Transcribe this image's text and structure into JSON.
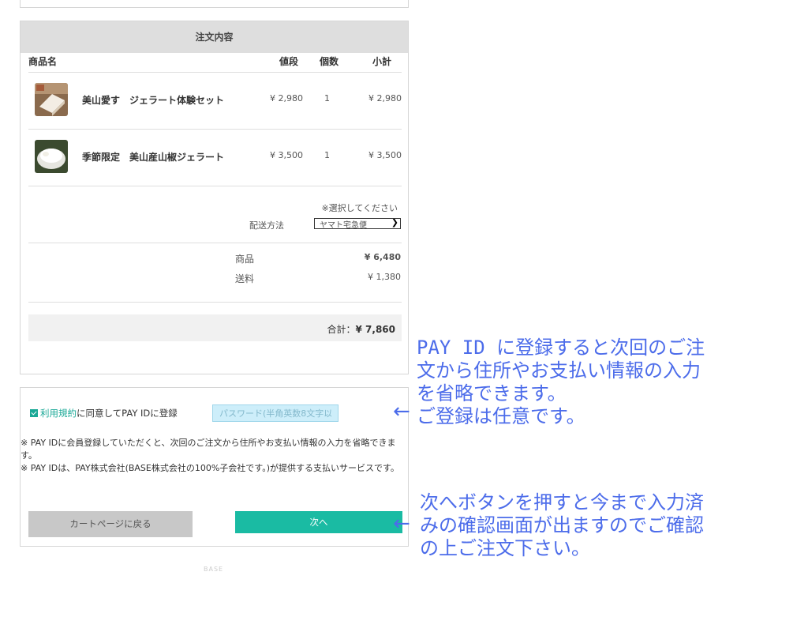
{
  "order": {
    "header": "注文内容",
    "columns": {
      "name": "商品名",
      "price": "値段",
      "qty": "個数",
      "subtotal": "小計"
    },
    "items": [
      {
        "name": "美山愛す　ジェラート体験セット",
        "price": "¥ 2,980",
        "qty": "1",
        "subtotal": "¥ 2,980"
      },
      {
        "name": "季節限定　美山産山椒ジェラート",
        "price": "¥ 3,500",
        "qty": "1",
        "subtotal": "¥ 3,500"
      }
    ],
    "shipping": {
      "note": "※選択してください",
      "label": "配送方法",
      "selected": "ヤマト宅急便"
    },
    "summary": {
      "products_label": "商品",
      "products_value": "¥ 6,480",
      "shipping_label": "送料",
      "shipping_value": "¥ 1,380"
    },
    "total": {
      "label": "合計：",
      "value": "¥ 7,860"
    }
  },
  "pay_id": {
    "terms_link": "利用規約",
    "agree_text": "に同意してPAY IDに登録",
    "password_placeholder": "パスワード(半角英数8文字以上)",
    "note1": "※ PAY IDに会員登録していただくと、次回のご注文から住所やお支払い情報の入力を省略できます。",
    "note2": "※ PAY IDは、PAY株式会社(BASE株式会社の100%子会社です。)が提供する支払いサービスです。",
    "back_button": "カートページに戻る",
    "next_button": "次へ"
  },
  "footer": {
    "mark": "BASE"
  },
  "annotations": {
    "pay_id_note": [
      "PAY ID に登録すると次回のご注",
      "文から住所やお支払い情報の入力",
      "を省略できます。",
      "ご登録は任意です。"
    ],
    "next_note": [
      "次へボタンを押すと今まで入力済",
      "みの確認画面が出ますのでご確認",
      "の上ご注文下さい。"
    ],
    "arrow": "←"
  },
  "colors": {
    "accent": "#1abba3",
    "annotation": "#4c6cea"
  }
}
